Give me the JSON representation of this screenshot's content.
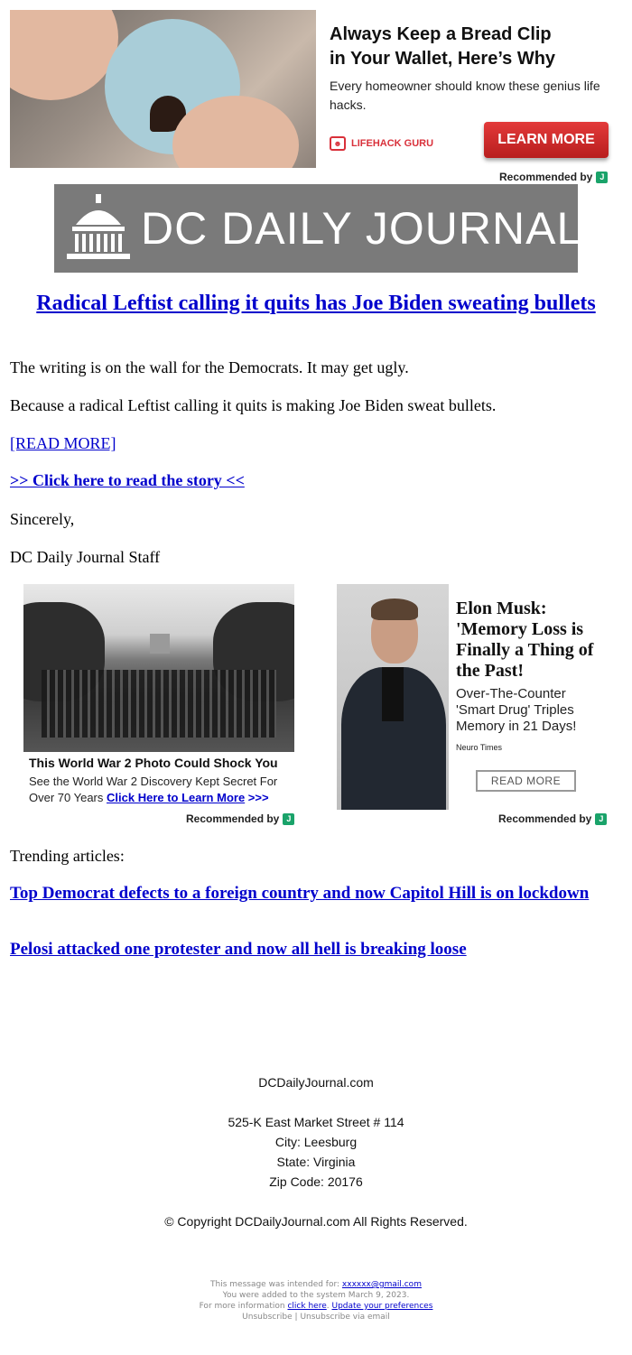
{
  "top_ad": {
    "title_line1": "Always Keep a Bread Clip",
    "title_line2": "in Your Wallet, Here’s Why",
    "subtitle": "Every homeowner should know these genius life hacks.",
    "brand": "LIFEHACK GURU",
    "button": "LEARN MORE",
    "recommended": "Recommended by",
    "rec_badge": "J"
  },
  "logo": {
    "text": "DC DAILY JOURNAL"
  },
  "article": {
    "headline": "Radical Leftist calling it quits has Joe Biden sweating bullets",
    "paragraph1": "The writing is on the wall for the Democrats. It may get ugly.",
    "paragraph2": "Because a radical Leftist calling it quits is making Joe Biden sweat bullets.",
    "read_more": "[READ MORE]",
    "click_here": ">> Click here to read the story <<",
    "closing": "Sincerely,",
    "signature": "DC Daily Journal Staff"
  },
  "ad_ww2": {
    "title": "This World War 2 Photo Could Shock You",
    "subtitle": "See the World War 2 Discovery Kept Secret For Over 70 Years",
    "link": "Click Here to Learn More",
    "arrows": ">>>",
    "recommended": "Recommended by",
    "rec_badge": "J"
  },
  "ad_musk": {
    "title": "Elon Musk: 'Memory Loss is Finally a Thing of the Past!",
    "subtitle": "Over-The-Counter 'Smart Drug' Triples Memory in 21 Days!",
    "source": "Neuro Times",
    "button": "READ MORE",
    "recommended": "Recommended by",
    "rec_badge": "J"
  },
  "trending": {
    "label": "Trending articles:",
    "items": [
      "Top Democrat defects to a foreign country and now Capitol Hill is on lockdown",
      "Pelosi attacked one protester and now all hell is breaking loose"
    ]
  },
  "footer": {
    "site": "DCDailyJournal.com",
    "street": "525-K East Market Street # 114",
    "city": "City: Leesburg",
    "state": "State: Virginia",
    "zip": "Zip Code: 20176",
    "copyright": "© Copyright DCDailyJournal.com All Rights Reserved.",
    "intended_prefix": "This message was intended for: ",
    "email": "xxxxxx@gmail.com",
    "added": "You were added to the system March 9, 2023.",
    "more_info_prefix": "For more information ",
    "click_here": "click here",
    "separator": ". ",
    "update_prefs": "Update your preferences",
    "unsubscribe": "Unsubscribe",
    "pipe": " | ",
    "unsubscribe_email": "Unsubscribe via email"
  },
  "colors": {
    "link": "#0000cc",
    "logo_bg": "#7a7a7a",
    "cta_red": "#d9303a",
    "rec_green": "#1aa36a"
  }
}
